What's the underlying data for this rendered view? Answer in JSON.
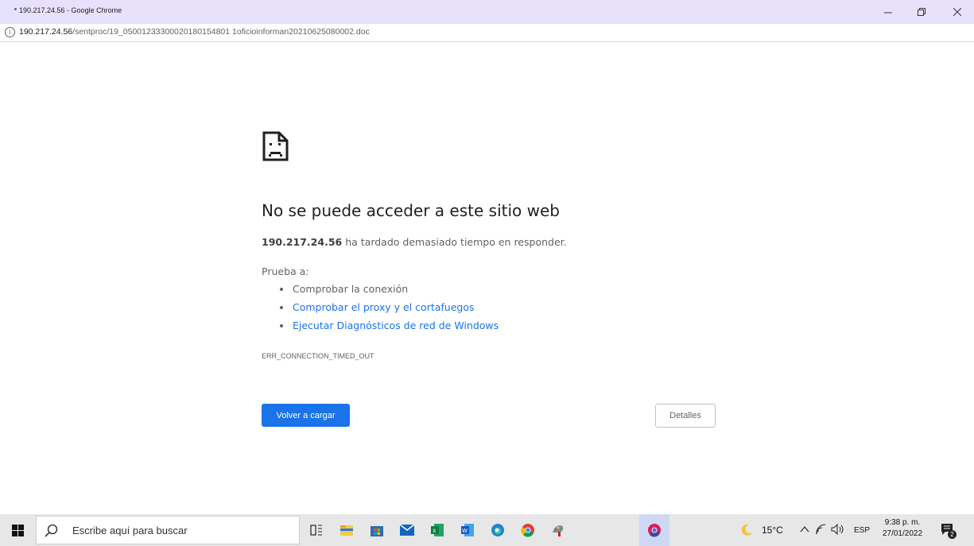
{
  "window": {
    "title": "190.217.24.56 - Google Chrome",
    "minimize_icon": "minimize-icon",
    "restore_icon": "restore-icon",
    "close_icon": "close-icon"
  },
  "address": {
    "host": "190.217.24.56",
    "path": "/sentproc/19_05001233300020180154801 1oficioinforman20210625080002.doc"
  },
  "error_page": {
    "heading": "No se puede acceder a este sitio web",
    "host_bold": "190.217.24.56",
    "message": " ha tardado demasiado tiempo en responder.",
    "try_label": "Prueba a:",
    "suggestions": [
      {
        "label": "Comprobar la conexión",
        "link": false
      },
      {
        "label": "Comprobar el proxy y el cortafuegos",
        "link": true
      },
      {
        "label": "Ejecutar Diagnósticos de red de Windows",
        "link": true
      }
    ],
    "error_code": "ERR_CONNECTION_TIMED_OUT",
    "reload_label": "Volver a cargar",
    "details_label": "Detalles"
  },
  "taskbar": {
    "search_placeholder": "Escribe aquí para buscar",
    "apps": [
      "task-view-icon",
      "file-explorer-icon",
      "store-icon",
      "mail-icon",
      "excel-icon",
      "word-icon",
      "edge-icon",
      "chrome-icon",
      "paint-icon",
      "chrome-canary-icon"
    ],
    "weather": "15°C",
    "language": "ESP",
    "time": "9:38 p. m.",
    "date": "27/01/2022",
    "notification_count": "2"
  },
  "colors": {
    "accent": "#1a73e8",
    "titlebar": "#e8e1fb",
    "taskbar": "#e7e7e7"
  }
}
